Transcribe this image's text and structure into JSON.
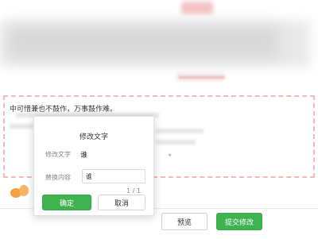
{
  "editor": {
    "first_line": "中可惜兼也不鼓作，万事鼓作难。",
    "last_line_end": "。"
  },
  "dialog": {
    "title": "修改文字",
    "edit_text_label": "修改文字",
    "edit_text_value": "谁",
    "replace_label": "替换内容",
    "replace_value": "谁",
    "pager": "1 / 1",
    "confirm_label": "确定",
    "cancel_label": "取消"
  },
  "footer": {
    "preview_label": "预览",
    "submit_label": "提交修改"
  },
  "colors": {
    "accent_green": "#3fb34f",
    "frame_pink": "#f5b9b9",
    "decor_orange": "#f5a040"
  },
  "icons": {
    "decor": "orange-leaf-icon"
  }
}
